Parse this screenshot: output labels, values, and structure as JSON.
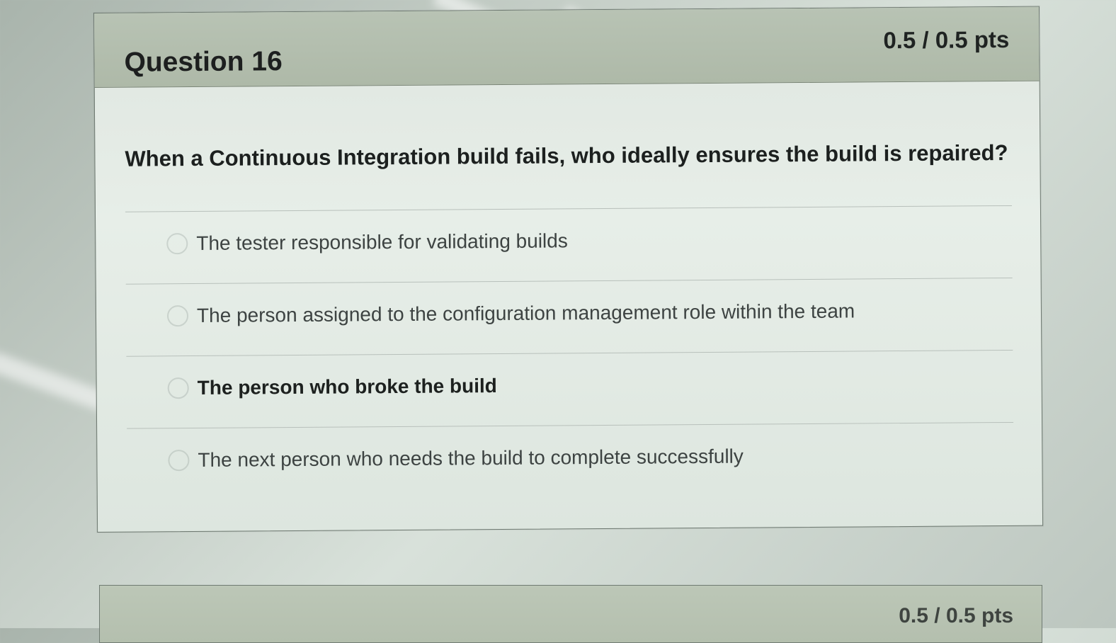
{
  "question_card": {
    "title": "Question 16",
    "points": "0.5 / 0.5 pts",
    "question_text": "When a Continuous Integration build fails, who ideally ensures the build is repaired?",
    "answers": [
      {
        "label": "The tester responsible for validating builds",
        "selected": false
      },
      {
        "label": "The person assigned to the configuration management role within the team",
        "selected": false
      },
      {
        "label": "The person who broke the build",
        "selected": true
      },
      {
        "label": "The next person who needs the build to complete successfully",
        "selected": false
      }
    ]
  },
  "next_card": {
    "points": "0.5 / 0.5 pts"
  }
}
